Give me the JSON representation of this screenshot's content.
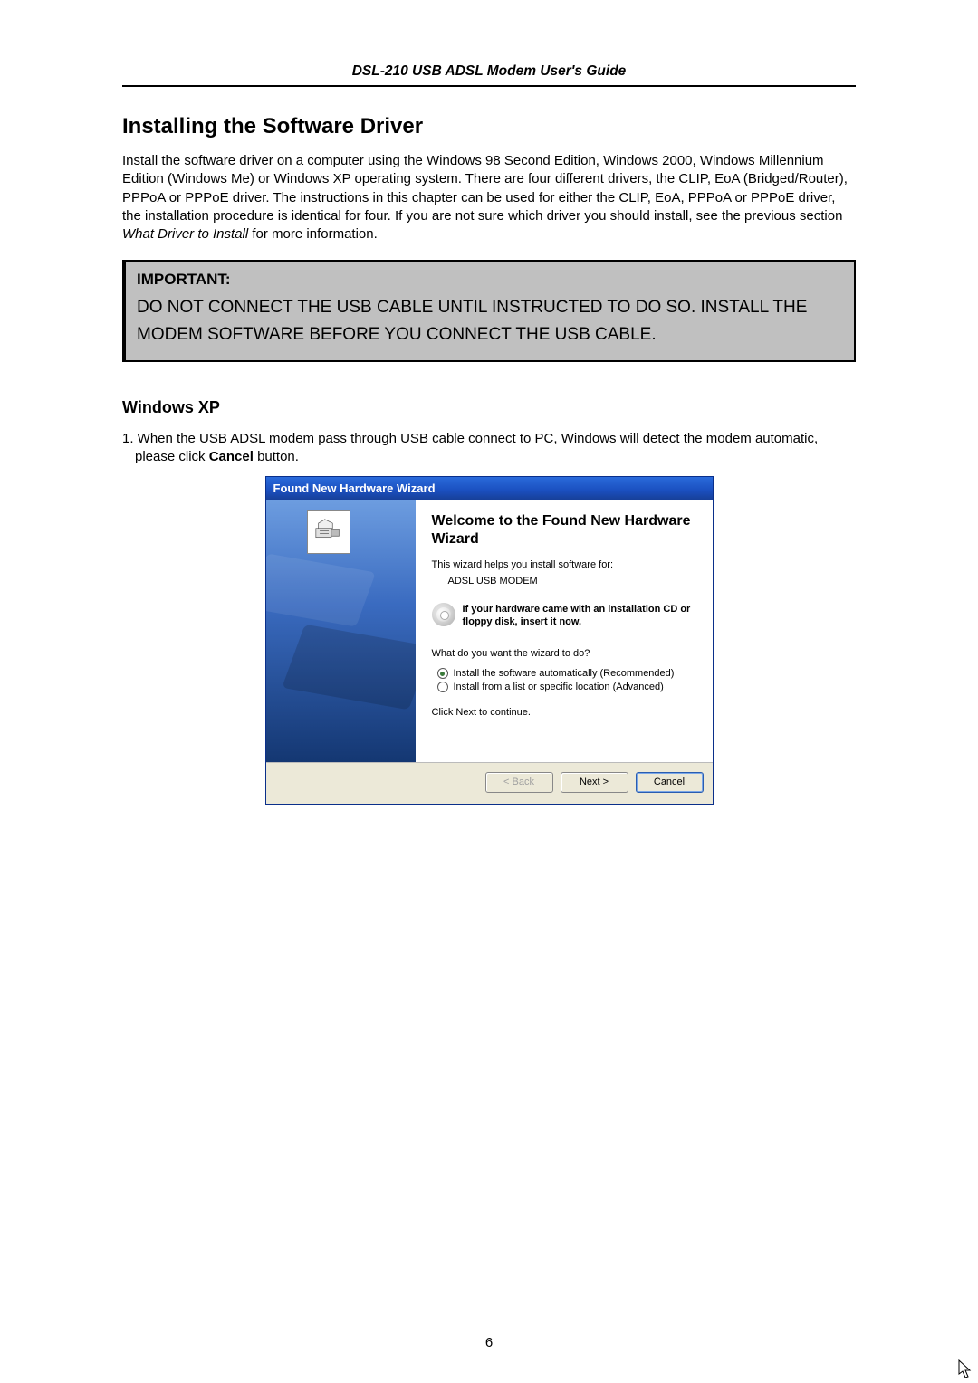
{
  "header": {
    "title": "DSL-210 USB ADSL Modem User's Guide"
  },
  "section": {
    "heading": "Installing the Software Driver",
    "intro_pre": "Install the software driver on a computer using the Windows 98 Second Edition, Windows 2000, Windows Millennium Edition (Windows Me) or Windows XP operating system. There are four different drivers, the CLIP, EoA (Bridged/Router), PPPoA or PPPoE driver. The instructions in this chapter can be used for either the CLIP, EoA, PPPoA or PPPoE driver, the installation procedure is identical for four. If you are not sure which driver you should install, see the previous section ",
    "intro_italic": "What Driver to Install",
    "intro_post": " for more information."
  },
  "important": {
    "label": "IMPORTANT:",
    "body": "DO NOT CONNECT THE USB CABLE UNTIL INSTRUCTED TO DO SO. INSTALL THE MODEM SOFTWARE BEFORE YOU CONNECT THE USB CABLE."
  },
  "sub": {
    "heading": "Windows XP",
    "step1_pre": "1. When the USB ADSL modem pass through USB cable connect to PC, Windows will detect the modem automatic, please click ",
    "step1_bold": "Cancel",
    "step1_post": " button."
  },
  "wizard": {
    "title": "Found New Hardware Wizard",
    "welcome": "Welcome to the Found New Hardware Wizard",
    "helps": "This wizard helps you install software for:",
    "device": "ADSL USB MODEM",
    "cd_text": "If your hardware came with an installation CD or floppy disk, insert it now.",
    "question": "What do you want the wizard to do?",
    "opt_auto": "Install the software automatically (Recommended)",
    "opt_list": "Install from a list or specific location (Advanced)",
    "continue": "Click Next to continue.",
    "buttons": {
      "back": "< Back",
      "next": "Next >",
      "cancel": "Cancel"
    }
  },
  "page_number": "6"
}
